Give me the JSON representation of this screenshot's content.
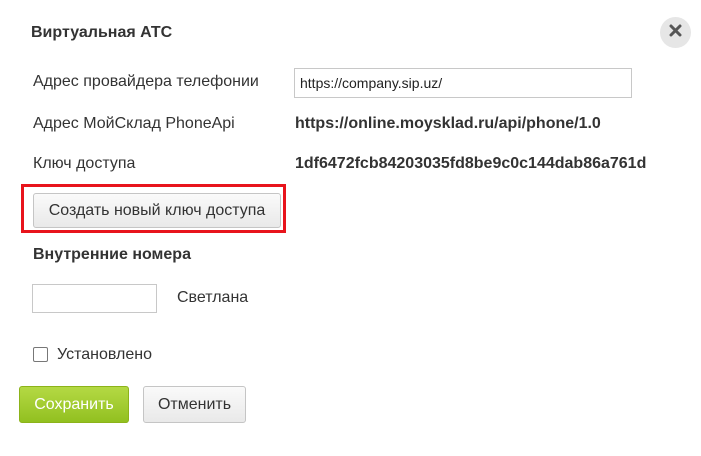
{
  "dialog": {
    "title": "Виртуальная АТС",
    "close_icon": "close-icon"
  },
  "fields": {
    "provider_address_label": "Адрес провайдера телефонии",
    "provider_address_value": "https://company.sip.uz/",
    "phoneapi_label": "Адрес МойСклад PhoneApi",
    "phoneapi_value": "https://online.moysklad.ru/api/phone/1.0",
    "access_key_label": "Ключ доступа",
    "access_key_value": "1df6472fcb84203035fd8be9c0c144dab86a761d",
    "new_key_button": "Создать новый ключ доступа"
  },
  "internal_numbers": {
    "section_title": "Внутренние номера",
    "rows": [
      {
        "number_value": "",
        "employee_name": "Светлана"
      }
    ]
  },
  "installed": {
    "label": "Установлено",
    "checked": false
  },
  "footer": {
    "save_button": "Сохранить",
    "cancel_button": "Отменить"
  },
  "colors": {
    "highlight": "#e8141c",
    "save_button": "#9cc62b"
  }
}
